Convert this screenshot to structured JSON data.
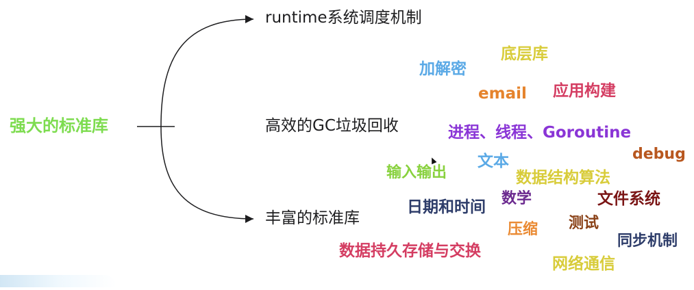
{
  "root": {
    "label": "强大的标准库"
  },
  "branches": [
    {
      "label": "runtime系统调度机制"
    },
    {
      "label": "高效的GC垃圾回收"
    },
    {
      "label": "丰富的标准库"
    }
  ],
  "tags": [
    {
      "label": "加解密",
      "color": "#5aa9e6"
    },
    {
      "label": "底层库",
      "color": "#d8cc3a"
    },
    {
      "label": "email",
      "color": "#e5832c"
    },
    {
      "label": "应用构建",
      "color": "#d43d62"
    },
    {
      "label": "进程、线程、Goroutine",
      "color": "#8a35d6"
    },
    {
      "label": "debug",
      "color": "#b8571f"
    },
    {
      "label": "文本",
      "color": "#5aa9e6"
    },
    {
      "label": "输入输出",
      "color": "#88d13d"
    },
    {
      "label": "数据结构算法",
      "color": "#d8cc3a"
    },
    {
      "label": "数学",
      "color": "#6b2a8f"
    },
    {
      "label": "文件系统",
      "color": "#7a1414"
    },
    {
      "label": "日期和时间",
      "color": "#2e3d6a"
    },
    {
      "label": "压缩",
      "color": "#ea8a33"
    },
    {
      "label": "测试",
      "color": "#8a4218"
    },
    {
      "label": "同步机制",
      "color": "#2e3d6a"
    },
    {
      "label": "数据持久存储与交换",
      "color": "#d43d62"
    },
    {
      "label": "网络通信",
      "color": "#d8cc3a"
    }
  ]
}
